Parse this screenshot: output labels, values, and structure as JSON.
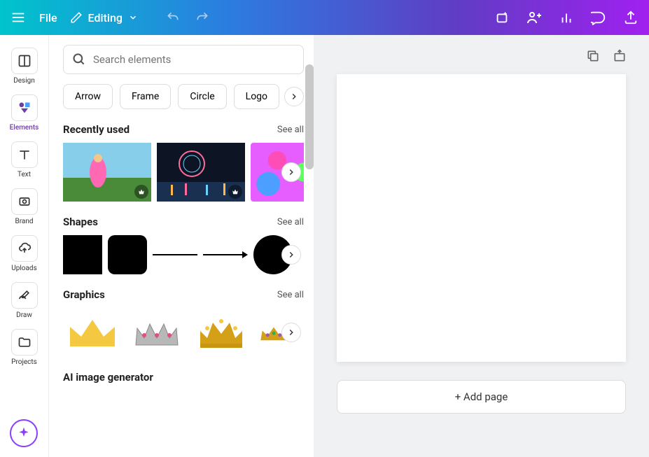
{
  "topbar": {
    "file_label": "File",
    "editing_label": "Editing"
  },
  "toolrail": {
    "items": [
      {
        "label": "Design"
      },
      {
        "label": "Elements"
      },
      {
        "label": "Text"
      },
      {
        "label": "Brand"
      },
      {
        "label": "Uploads"
      },
      {
        "label": "Draw"
      },
      {
        "label": "Projects"
      }
    ]
  },
  "search": {
    "placeholder": "Search elements"
  },
  "chips": [
    "Arrow",
    "Frame",
    "Circle",
    "Logo"
  ],
  "sections": {
    "recent": {
      "title": "Recently used",
      "seeall": "See all"
    },
    "shapes": {
      "title": "Shapes",
      "seeall": "See all"
    },
    "graphics": {
      "title": "Graphics",
      "seeall": "See all"
    },
    "ai": {
      "title": "AI image generator"
    }
  },
  "canvas": {
    "addpage": "+ Add page"
  }
}
